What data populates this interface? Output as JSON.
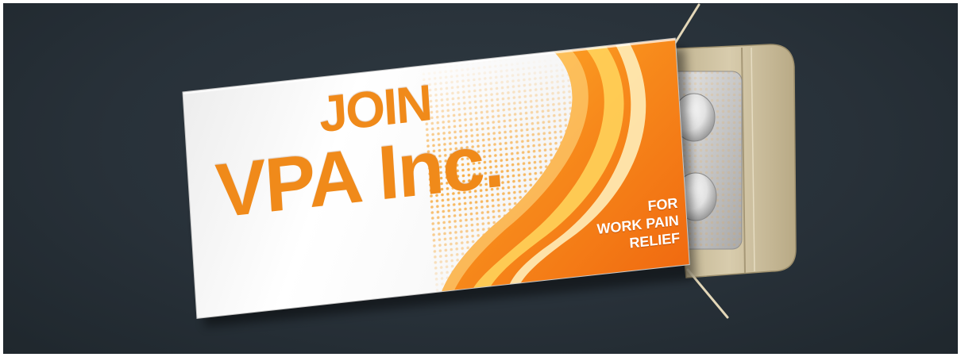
{
  "banner": {
    "headline_line1": "JOIN",
    "headline_line2": "VPA Inc.",
    "tagline_line1": "FOR",
    "tagline_line2": "WORK PAIN",
    "tagline_line3": "RELIEF"
  },
  "colors": {
    "background": "#283139",
    "accent_orange": "#f08a1a",
    "box_white": "#f4f4f4",
    "tray_beige": "#c9bc99"
  },
  "icons": [
    "pill-icon",
    "pill-icon"
  ]
}
